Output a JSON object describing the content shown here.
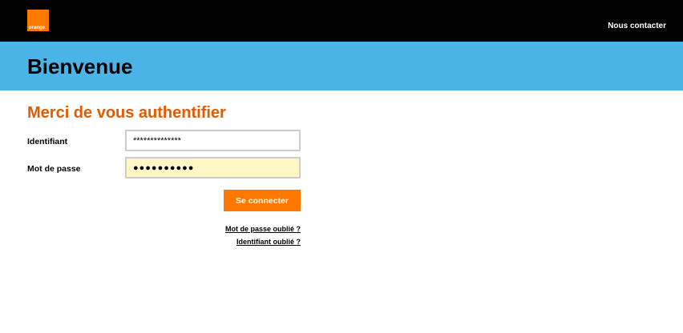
{
  "header": {
    "logo_text": "orange",
    "contact_label": "Nous contacter",
    "brand_color": "#ff7900"
  },
  "banner": {
    "title": "Bienvenue",
    "color": "#4bb4e6"
  },
  "form": {
    "title": "Merci de vous authentifier",
    "identifier_label": "Identifiant",
    "identifier_value": "**************",
    "password_label": "Mot de passe",
    "password_value": "●●●●●●●●●●",
    "submit_label": "Se connecter",
    "forgot_password_label": "Mot de passe oublié ?",
    "forgot_identifier_label": "Identifiant oublié ?",
    "title_color": "#e35a00"
  }
}
